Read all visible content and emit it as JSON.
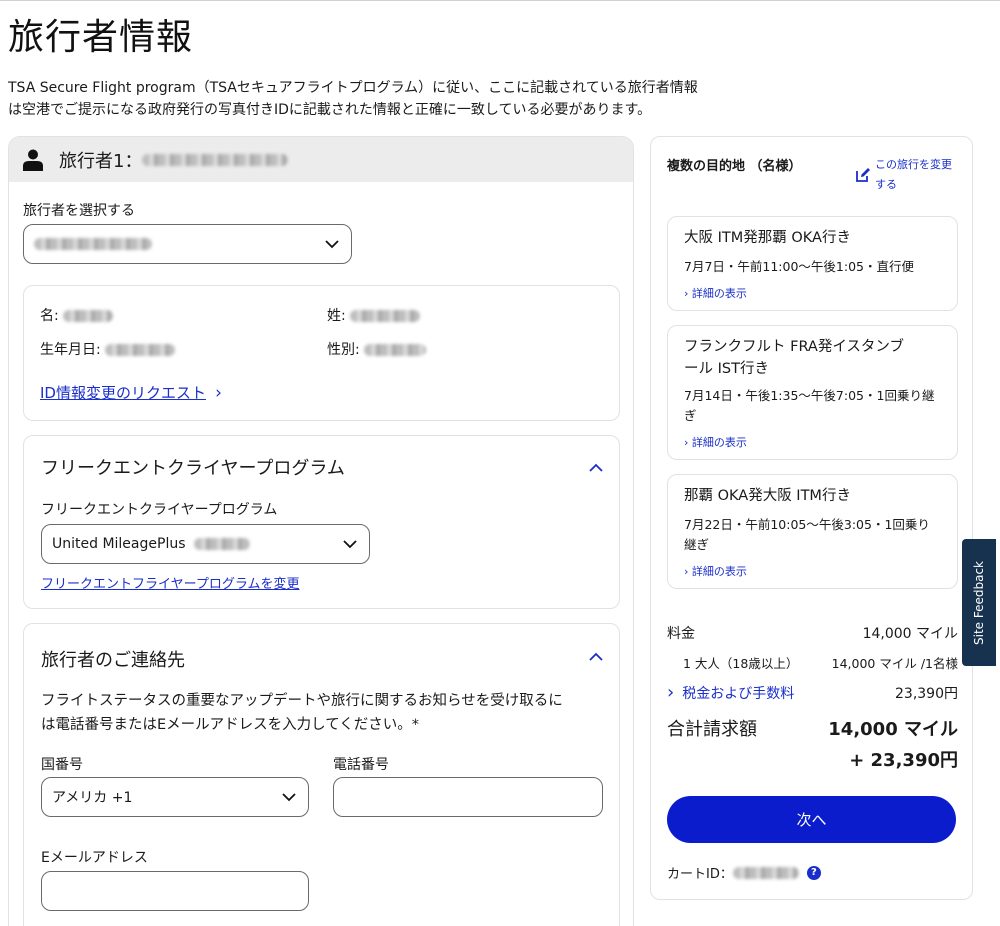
{
  "page": {
    "title": "旅行者情報",
    "intro_line1": "TSA Secure Flight program（TSAセキュアフライトプログラム）に従い、ここに記載されている旅行者情報",
    "intro_line2": "は空港でご提示になる政府発行の写真付きIDに記載された情報と正確に一致している必要があります。"
  },
  "traveler": {
    "heading": "旅行者1：",
    "select_label": "旅行者を選択する",
    "first_name_label": "名:",
    "last_name_label": "姓:",
    "dob_label": "生年月日:",
    "gender_label": "性別:",
    "id_change_link": "ID情報変更のリクエスト",
    "id_change_chevron": "›"
  },
  "frequent_flyer": {
    "section_title": "フリークエントクライヤープログラム",
    "field_label": "フリークエントクライヤープログラム",
    "selected_value": "United MileagePlus",
    "change_link": "フリークエントフライヤープログラムを変更"
  },
  "contact": {
    "section_title": "旅行者のご連絡先",
    "description_line1": "フライトステータスの重要なアップデートや旅行に関するお知らせを受け取るに",
    "description_line2": "は電話番号またはEメールアドレスを入力してください。*",
    "country_code_label": "国番号",
    "country_code_value": "アメリカ +1",
    "phone_label": "電話番号",
    "email_label": "Eメールアドレス"
  },
  "summary": {
    "title": "複数の目的地 （名様）",
    "change_trip": "この旅行を変更する",
    "segments": [
      {
        "route_line1": "大阪 ITM発那覇 OKA行き",
        "route_line2": "",
        "time_line1": "7月7日・午前11:00～午後1:05・直行便",
        "time_line2": "",
        "detail": "› 詳細の表示"
      },
      {
        "route_line1": "フランクフルト FRA発イスタンブ",
        "route_line2": "ール IST行き",
        "time_line1": "7月14日・午後1:35～午後7:05・1回乗り継",
        "time_line2": "ぎ",
        "detail": "› 詳細の表示"
      },
      {
        "route_line1": "那覇 OKA発大阪 ITM行き",
        "route_line2": "",
        "time_line1": "7月22日・午前10:05～午後3:05・1回乗り",
        "time_line2": "継ぎ",
        "detail": "› 詳細の表示"
      }
    ],
    "fare_label": "料金",
    "fare_value": "14,000 マイル",
    "adult_label": "1 大人（18歳以上）",
    "adult_value": "14,000 マイル /1名様",
    "tax_chevron": "›",
    "tax_label": "税金および手数料",
    "tax_value": "23,390円",
    "total_label": "合計請求額",
    "total_miles": "14,000 マイル",
    "total_yen": "+ 23,390円",
    "next_button": "次へ",
    "cart_id_label": "カートID：",
    "help_glyph": "?"
  },
  "feedback": {
    "label": "Site Feedback"
  },
  "colors": {
    "primary_button": "#0b1ccd",
    "link": "#1a2ec9",
    "feedback_tab": "#16324f"
  }
}
